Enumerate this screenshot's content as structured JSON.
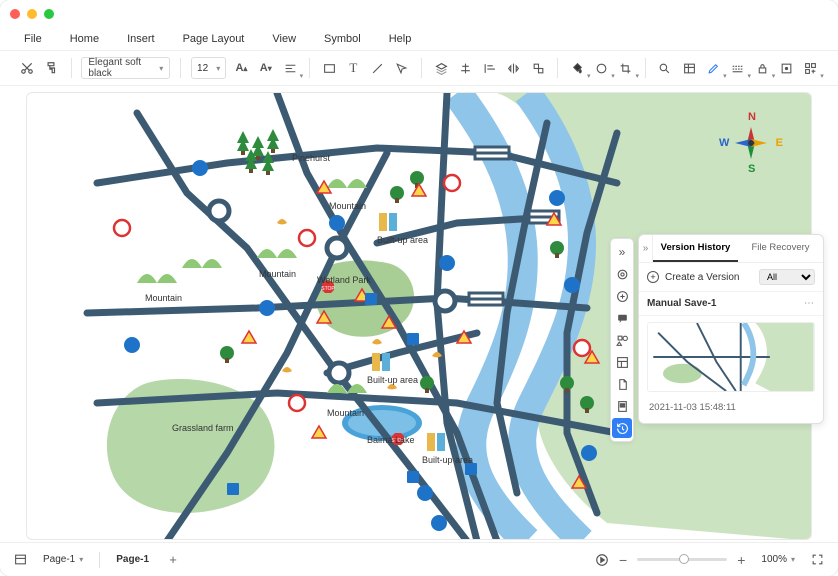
{
  "menu": {
    "file": "File",
    "home": "Home",
    "insert": "Insert",
    "page_layout": "Page Layout",
    "view": "View",
    "symbol": "Symbol",
    "help": "Help"
  },
  "toolbar": {
    "font": "Elegant soft black",
    "size": "12"
  },
  "vpanel": {
    "tab_version": "Version History",
    "tab_recovery": "File Recovery",
    "create": "Create a Version",
    "filter": "All",
    "save_name": "Manual Save-1",
    "timestamp": "2021-11-03 15:48:11"
  },
  "compass": {
    "n": "N",
    "s": "S",
    "e": "E",
    "w": "W"
  },
  "map_labels": {
    "pinehurst": "Pinehurst",
    "mountain_a": "Mountain",
    "mountain_b": "Mountain",
    "mountain_c": "Mountain",
    "mountain_d": "Mountain",
    "wetland": "Wetland Park",
    "builtup_a": "Built-up area",
    "builtup_b": "Built-up area",
    "builtup_c": "Built-up area",
    "grassland": "Grassland farm",
    "baima": "Baima Lake"
  },
  "status": {
    "page_selector": "Page-1",
    "page_tab": "Page-1",
    "zoom": "100%"
  }
}
